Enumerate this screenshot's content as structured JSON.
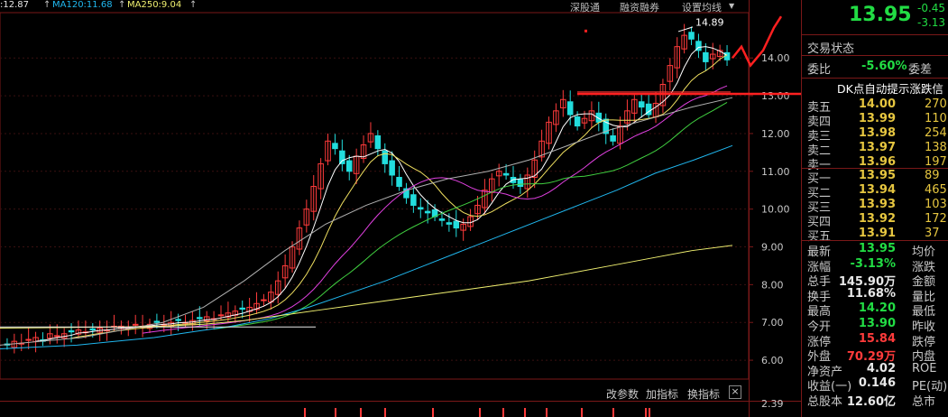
{
  "indicators": {
    "ma60": ":12.87",
    "ma120": "MA120:11.68",
    "ma250": "MA250:9.04"
  },
  "toolbar": {
    "shengutong": "深股通",
    "rongzi": "融资融券",
    "settings": "设置均线",
    "gaicanshu": "改参数",
    "jiazhibiao": "加指标",
    "huanzhibiao": "换指标",
    "close": "×"
  },
  "price_axis": {
    "ticks": [
      "14.00",
      "13.00",
      "12.00",
      "11.00",
      "10.00",
      "9.00",
      "8.00",
      "7.00",
      "6.00"
    ],
    "lower_pane_tick": "2.39"
  },
  "annotation": {
    "peak_label": "14.89",
    "arrow_text": "DK点自动提示涨跌信"
  },
  "quote": {
    "price": "13.95",
    "change": "-0.45",
    "change_pct": "-3.13",
    "trade_status": "交易状态",
    "weibi_label": "委比",
    "weibi_value": "-5.60%",
    "weicha_label": "委差",
    "sell": [
      {
        "label": "卖五",
        "price": "14.00",
        "vol": "270"
      },
      {
        "label": "卖四",
        "price": "13.99",
        "vol": "110"
      },
      {
        "label": "卖三",
        "price": "13.98",
        "vol": "254"
      },
      {
        "label": "卖二",
        "price": "13.97",
        "vol": "138"
      },
      {
        "label": "卖一",
        "price": "13.96",
        "vol": "197"
      }
    ],
    "buy": [
      {
        "label": "买一",
        "price": "13.95",
        "vol": "89"
      },
      {
        "label": "买二",
        "price": "13.94",
        "vol": "465"
      },
      {
        "label": "买三",
        "price": "13.93",
        "vol": "103"
      },
      {
        "label": "买四",
        "price": "13.92",
        "vol": "172"
      },
      {
        "label": "买五",
        "price": "13.91",
        "vol": "37"
      }
    ],
    "stats": [
      {
        "l1": "最新",
        "v": "13.95",
        "l2": "均价",
        "color": "g"
      },
      {
        "l1": "涨幅",
        "v": "-3.13%",
        "l2": "涨跌",
        "color": "g"
      },
      {
        "l1": "总手",
        "v": "145.90万",
        "l2": "金额",
        "color": "w"
      },
      {
        "l1": "换手",
        "v": "11.68%",
        "l2": "量比",
        "color": "w"
      },
      {
        "l1": "最高",
        "v": "14.20",
        "l2": "最低",
        "color": "g"
      },
      {
        "l1": "今开",
        "v": "13.90",
        "l2": "昨收",
        "color": "g"
      },
      {
        "l1": "涨停",
        "v": "15.84",
        "l2": "跌停",
        "color": "r"
      },
      {
        "l1": "外盘",
        "v": "70.29万",
        "l2": "内盘",
        "color": "r"
      },
      {
        "l1": "净资产",
        "v": "4.02",
        "l2": "ROE",
        "color": "w"
      },
      {
        "l1": "收益(一)",
        "v": "0.146",
        "l2": "PE(动)",
        "color": "w"
      },
      {
        "l1": "总股本",
        "v": "12.60亿",
        "l2": "总市",
        "color": "w"
      }
    ]
  },
  "colors": {
    "up": "#ff3b3b",
    "down": "#22dddd",
    "ma5": "#ffffff",
    "ma10": "#f0e060",
    "ma20": "#e040e0",
    "ma30": "#40d040",
    "ma60": "#b0b0b0",
    "ma120": "#20b8f0",
    "ma250": "#f0f070"
  },
  "chart_data": {
    "type": "candlestick",
    "ylim": [
      5.5,
      15.2
    ],
    "closes": [
      6.4,
      6.5,
      6.45,
      6.55,
      6.6,
      6.5,
      6.7,
      6.65,
      6.7,
      6.75,
      6.8,
      6.75,
      6.8,
      6.85,
      6.8,
      6.9,
      6.9,
      6.85,
      6.95,
      6.9,
      6.95,
      7.0,
      6.95,
      7.0,
      7.05,
      7.0,
      7.05,
      7.1,
      7.15,
      7.1,
      7.2,
      7.25,
      7.3,
      7.35,
      7.4,
      7.5,
      7.6,
      7.8,
      8.1,
      8.5,
      9.0,
      9.5,
      10.0,
      10.6,
      11.2,
      11.8,
      11.6,
      11.2,
      11.0,
      11.4,
      11.7,
      12.0,
      11.6,
      11.2,
      10.9,
      10.6,
      10.3,
      10.1,
      10.0,
      9.9,
      9.8,
      9.7,
      9.6,
      9.5,
      9.6,
      9.8,
      10.1,
      10.5,
      10.8,
      11.0,
      10.9,
      10.7,
      10.6,
      10.9,
      11.3,
      11.8,
      12.3,
      12.6,
      12.9,
      12.5,
      12.2,
      12.4,
      12.6,
      12.3,
      12.0,
      11.8,
      12.2,
      12.6,
      12.9,
      12.7,
      12.5,
      12.8,
      13.3,
      13.8,
      14.3,
      14.6,
      14.5,
      14.2,
      13.9,
      14.1,
      14.2,
      13.95
    ],
    "series": [
      {
        "name": "MA60",
        "values": [
          6.4,
          6.5,
          6.6,
          6.8,
          7.0,
          7.4,
          8.1,
          8.9,
          9.6,
          10.1,
          10.5,
          10.8,
          11.0,
          11.3,
          11.7,
          12.1,
          12.4,
          12.7,
          12.95
        ]
      },
      {
        "name": "MA120",
        "values": [
          6.3,
          6.35,
          6.4,
          6.5,
          6.6,
          6.75,
          6.9,
          7.1,
          7.4,
          7.75,
          8.1,
          8.5,
          8.9,
          9.3,
          9.7,
          10.1,
          10.5,
          10.95,
          11.3,
          11.68
        ]
      },
      {
        "name": "MA250",
        "values": [
          6.85,
          6.86,
          6.87,
          6.88,
          6.9,
          6.95,
          7.05,
          7.2,
          7.35,
          7.5,
          7.65,
          7.8,
          7.95,
          8.1,
          8.3,
          8.5,
          8.7,
          8.9,
          9.04
        ]
      }
    ]
  }
}
